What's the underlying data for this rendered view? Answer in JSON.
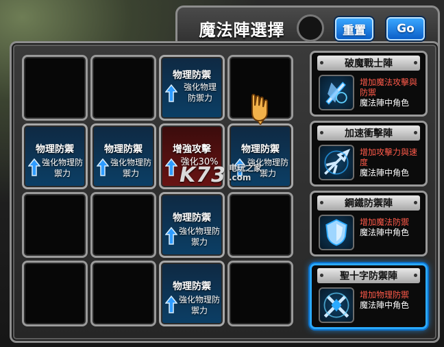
{
  "header": {
    "title": "魔法陣選擇",
    "reset_label": "重置",
    "go_label": "Go"
  },
  "grid": {
    "rows": [
      [
        {
          "type": "empty"
        },
        {
          "type": "empty"
        },
        {
          "type": "slot",
          "name": "物理防禦",
          "effect": "強化物理防禦力",
          "color": "blue"
        },
        {
          "type": "empty"
        }
      ],
      [
        {
          "type": "slot",
          "name": "物理防禦",
          "effect": "強化物理防禦力",
          "color": "blue"
        },
        {
          "type": "slot",
          "name": "物理防禦",
          "effect": "強化物理防禦力",
          "color": "blue"
        },
        {
          "type": "slot",
          "name": "增強攻擊",
          "effect": "強化30%",
          "color": "red"
        },
        {
          "type": "slot",
          "name": "物理防禦",
          "effect": "強化物理防禦力",
          "color": "blue"
        }
      ],
      [
        {
          "type": "empty"
        },
        {
          "type": "empty"
        },
        {
          "type": "slot",
          "name": "物理防禦",
          "effect": "強化物理防禦力",
          "color": "blue"
        },
        {
          "type": "empty"
        }
      ],
      [
        {
          "type": "empty"
        },
        {
          "type": "empty"
        },
        {
          "type": "slot",
          "name": "物理防禦",
          "effect": "強化物理防禦力",
          "color": "blue"
        },
        {
          "type": "empty"
        }
      ]
    ]
  },
  "formations": [
    {
      "name": "破魔戰士陣",
      "effect": "增加魔法攻擊與防禦",
      "target": "魔法陣中角色",
      "icon": "sword-shield-icon",
      "selected": false
    },
    {
      "name": "加速衝擊陣",
      "effect": "增加攻擊力與速度",
      "target": "魔法陣中角色",
      "icon": "arrow-burst-icon",
      "selected": false
    },
    {
      "name": "鋼鐵防禦陣",
      "effect": "增加魔法防禦",
      "target": "魔法陣中角色",
      "icon": "shield-icon",
      "selected": false
    },
    {
      "name": "聖十字防禦陣",
      "effect": "增加物理防禦",
      "target": "魔法陣中角色",
      "icon": "cross-shield-icon",
      "selected": true
    }
  ],
  "watermark": {
    "logo": "K73",
    "site_line1": "电玩之家",
    "site_line2": ".com"
  },
  "colors": {
    "accent_blue": "#1f9bff",
    "effect_red": "#ff5a4a",
    "attack_red": "#6a1414"
  }
}
